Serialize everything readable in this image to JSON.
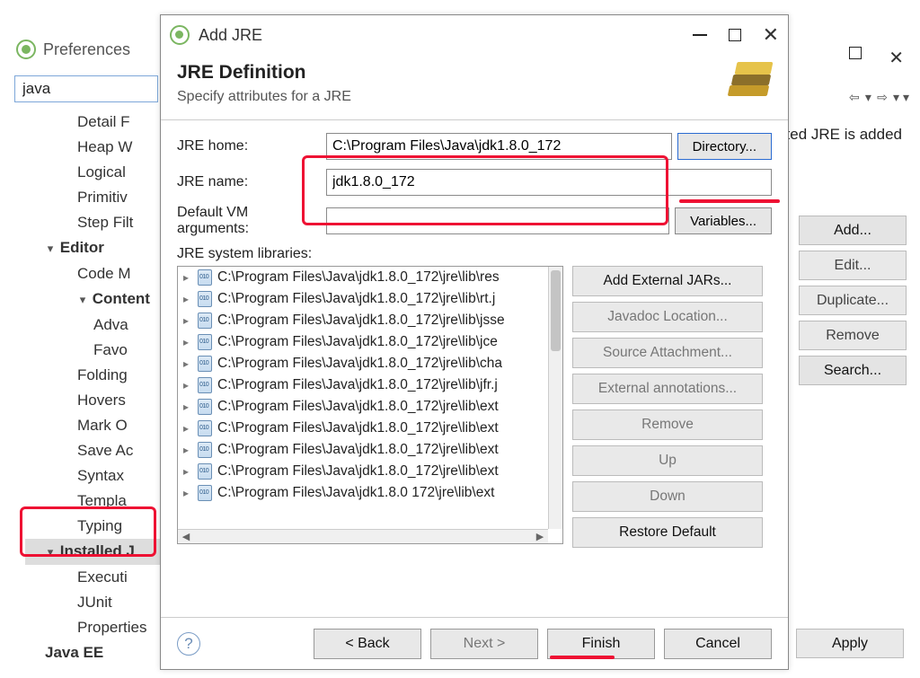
{
  "preferences": {
    "title": "Preferences",
    "search_value": "java",
    "right_note": "ted JRE is added",
    "tree": {
      "items": [
        "Detail F",
        "Heap W",
        "Logical",
        "Primitiv",
        "Step Filt"
      ],
      "editor": {
        "label": "Editor",
        "items": [
          "Code M"
        ],
        "content": {
          "label": "Content",
          "items": [
            "Adva",
            "Favo"
          ]
        },
        "tail": [
          "Folding",
          "Hovers",
          "Mark O",
          "Save Ac",
          "Syntax",
          "Templa",
          "Typing"
        ]
      },
      "installed": "Installed J",
      "tail2": [
        "Executi",
        "JUnit",
        "Properties"
      ],
      "javaee": "Java EE"
    },
    "side_buttons": {
      "add": "Add...",
      "edit": "Edit...",
      "duplicate": "Duplicate...",
      "remove": "Remove",
      "search": "Search..."
    },
    "apply": "Apply"
  },
  "dialog": {
    "title": "Add JRE",
    "heading": "JRE Definition",
    "subheading": "Specify attributes for a JRE",
    "labels": {
      "jre_home": "JRE home:",
      "jre_name": "JRE name:",
      "vm_args": "Default VM arguments:",
      "sys_libs": "JRE system libraries:"
    },
    "values": {
      "jre_home": "C:\\Program Files\\Java\\jdk1.8.0_172",
      "jre_name": "jdk1.8.0_172",
      "vm_args": ""
    },
    "buttons": {
      "directory": "Directory...",
      "variables": "Variables...",
      "add_ext": "Add External JARs...",
      "javadoc": "Javadoc Location...",
      "src": "Source Attachment...",
      "ext_ann": "External annotations...",
      "remove": "Remove",
      "up": "Up",
      "down": "Down",
      "restore": "Restore Default",
      "back": "<  Back",
      "next": "Next  >",
      "finish": "Finish",
      "cancel": "Cancel"
    },
    "libs": [
      "C:\\Program Files\\Java\\jdk1.8.0_172\\jre\\lib\\res",
      "C:\\Program Files\\Java\\jdk1.8.0_172\\jre\\lib\\rt.j",
      "C:\\Program Files\\Java\\jdk1.8.0_172\\jre\\lib\\jsse",
      "C:\\Program Files\\Java\\jdk1.8.0_172\\jre\\lib\\jce",
      "C:\\Program Files\\Java\\jdk1.8.0_172\\jre\\lib\\cha",
      "C:\\Program Files\\Java\\jdk1.8.0_172\\jre\\lib\\jfr.j",
      "C:\\Program Files\\Java\\jdk1.8.0_172\\jre\\lib\\ext",
      "C:\\Program Files\\Java\\jdk1.8.0_172\\jre\\lib\\ext",
      "C:\\Program Files\\Java\\jdk1.8.0_172\\jre\\lib\\ext",
      "C:\\Program Files\\Java\\jdk1.8.0_172\\jre\\lib\\ext",
      "C:\\Program Files\\Java\\jdk1.8.0 172\\jre\\lib\\ext"
    ]
  }
}
